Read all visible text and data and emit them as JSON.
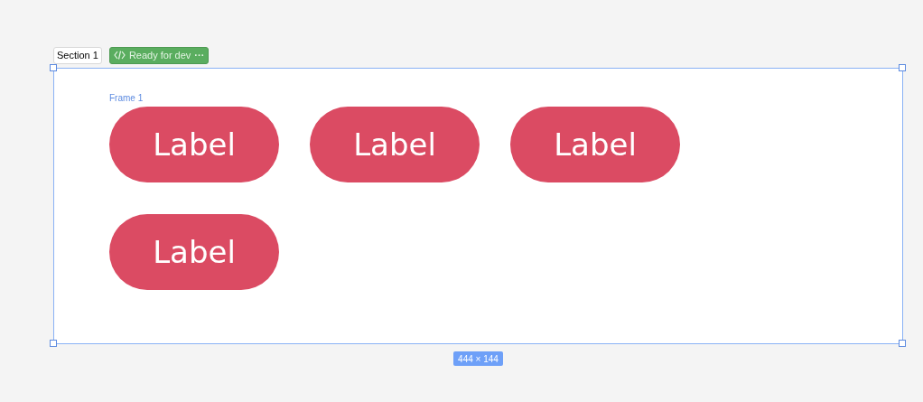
{
  "section": {
    "title": "Section 1",
    "status": "Ready for dev",
    "status_menu": "···"
  },
  "frame": {
    "title": "Frame 1",
    "buttons": [
      {
        "label": "Label"
      },
      {
        "label": "Label"
      },
      {
        "label": "Label"
      },
      {
        "label": "Label"
      }
    ]
  },
  "dimensions": "444 × 144"
}
